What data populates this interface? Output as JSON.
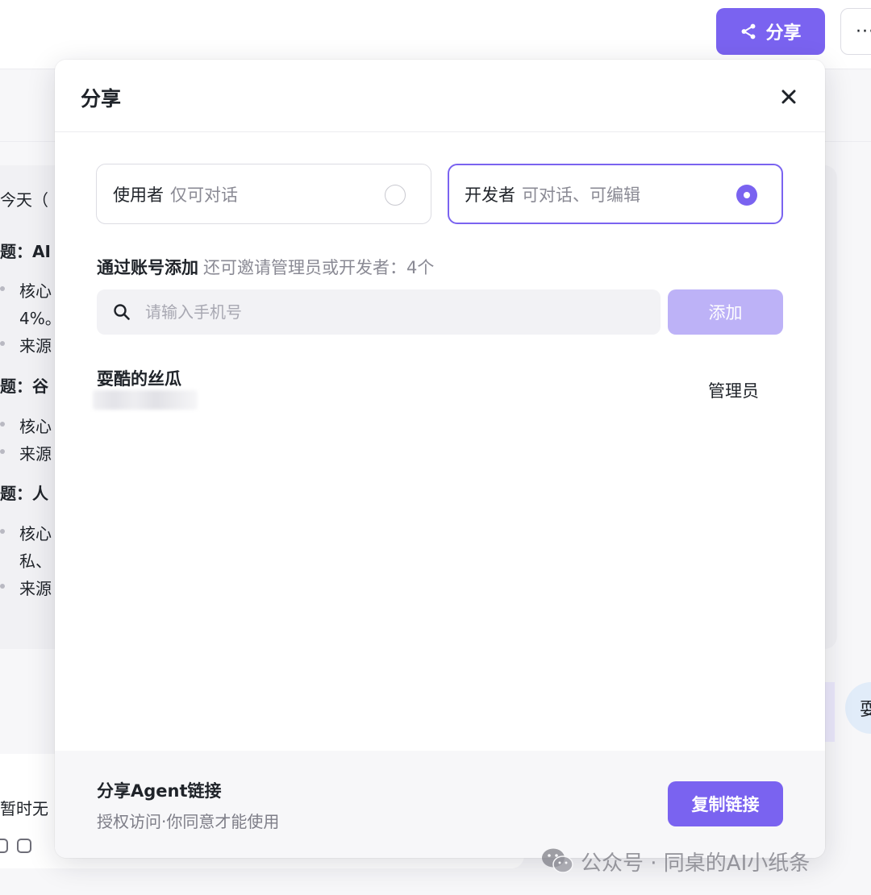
{
  "topbar": {
    "share_label": "分享",
    "more_label": "···"
  },
  "background": {
    "lines": [
      "今天（",
      "题：AI",
      "核心",
      "4%。",
      "来源",
      "题：谷",
      "核心",
      "来源",
      "题：人",
      "核心",
      "私、",
      "来源"
    ],
    "empty_hint": "暂时无",
    "avatar_text": "耍"
  },
  "modal": {
    "title": "分享",
    "roles": [
      {
        "name": "使用者",
        "desc": "仅可对话",
        "selected": false
      },
      {
        "name": "开发者",
        "desc": "可对话、可编辑",
        "selected": true
      }
    ],
    "invite": {
      "label": "通过账号添加",
      "hint": "还可邀请管理员或开发者：4个"
    },
    "search": {
      "placeholder": "请输入手机号",
      "value": ""
    },
    "add_button": "添加",
    "members": [
      {
        "name": "耍酷的丝瓜",
        "role": "管理员"
      }
    ],
    "footer": {
      "title": "分享Agent链接",
      "subtitle": "授权访问·你同意才能使用",
      "copy_button": "复制链接"
    }
  },
  "watermark": "公众号 · 同桌的AI小纸条",
  "colors": {
    "accent": "#7a63f0",
    "accent_disabled": "#bdb2f7"
  }
}
